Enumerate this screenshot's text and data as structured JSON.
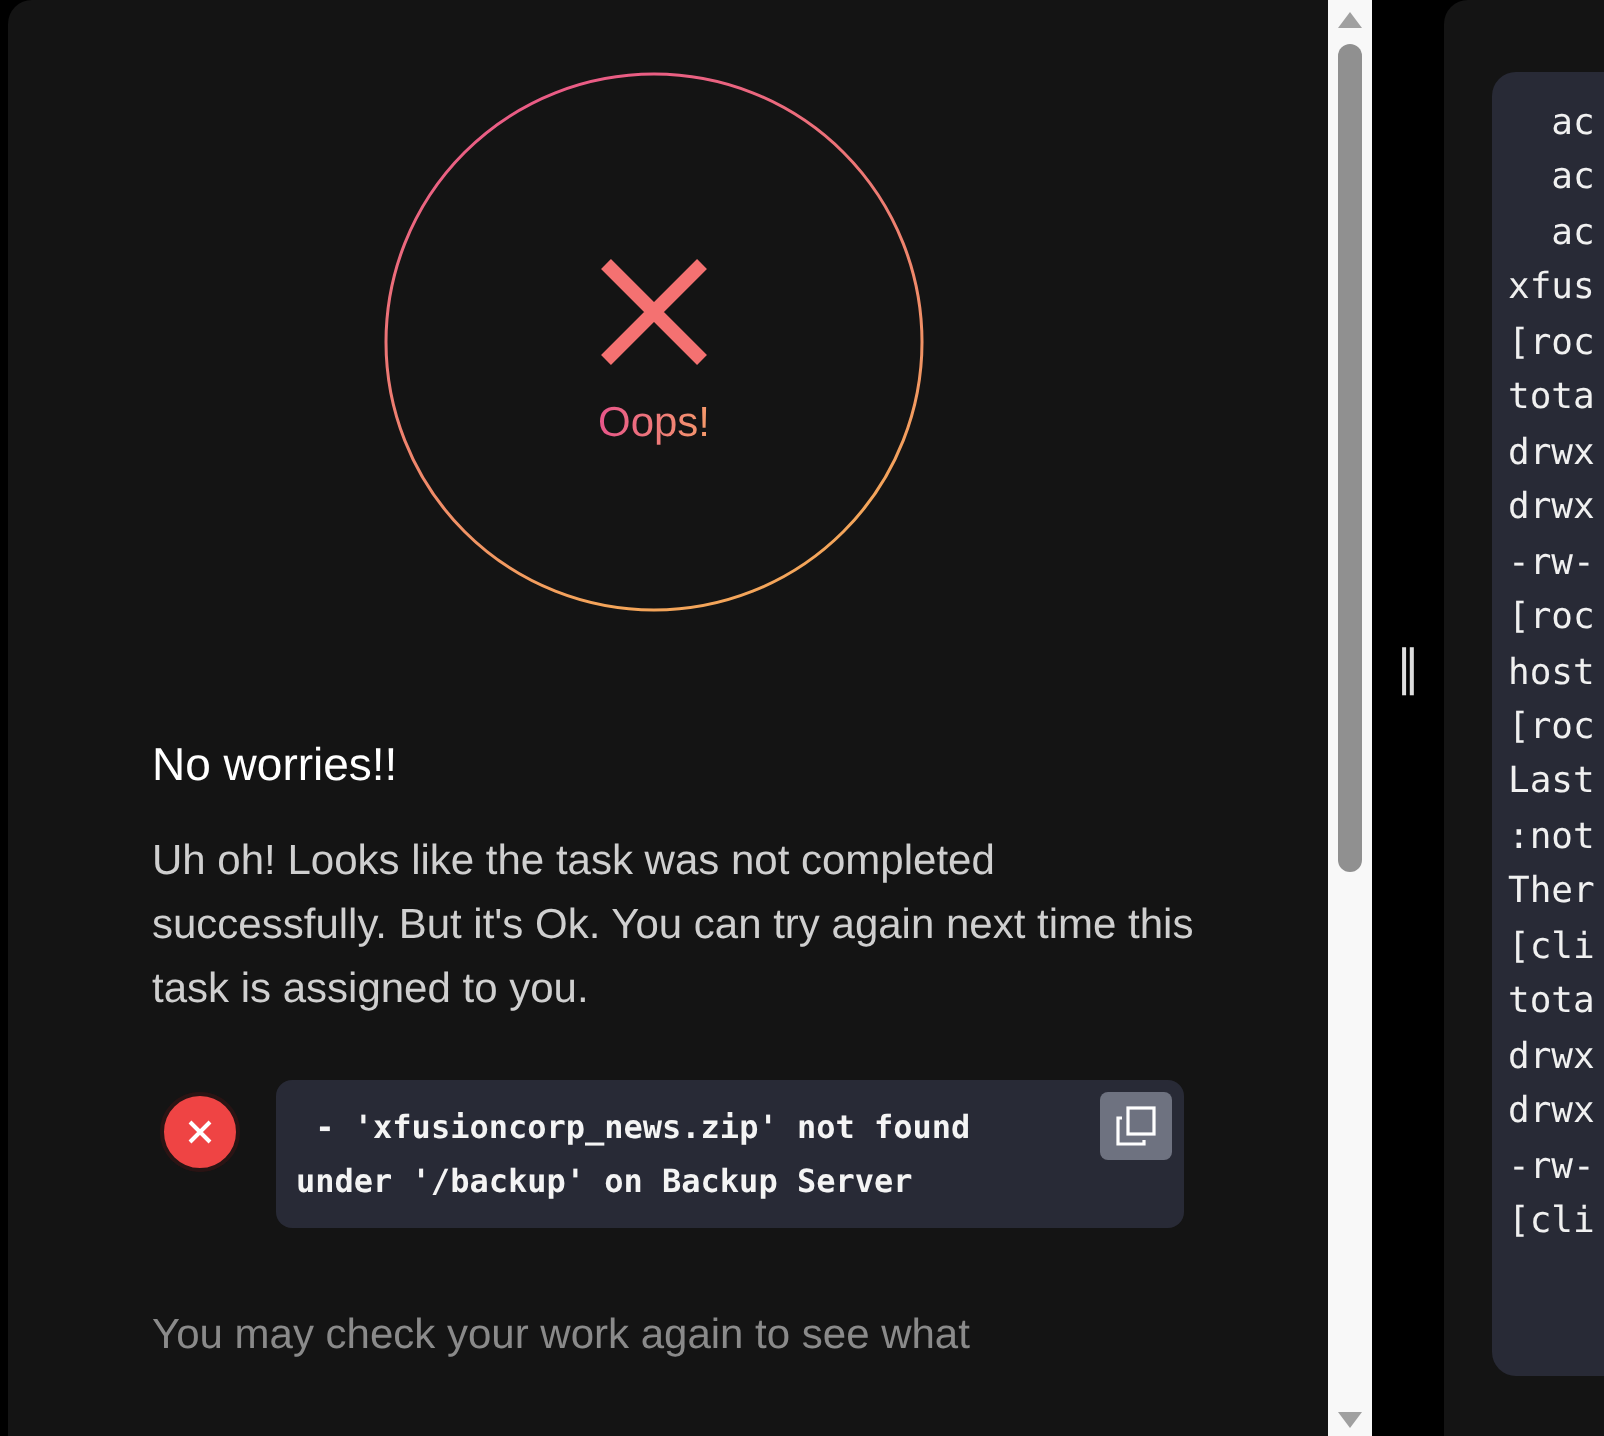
{
  "result": {
    "status_label": "Oops!",
    "heading": "No worries!!",
    "message": "Uh oh! Looks like the task was not completed successfully. But it's Ok. You can try again next time this task is assigned to you.",
    "errors": [
      {
        "text": " - 'xfusioncorp_news.zip' not found under '/backup' on Backup Server"
      }
    ],
    "footer": "You may check your work again to see what"
  },
  "splitter": {
    "label": "‖"
  },
  "terminal": {
    "lines": [
      "  ac",
      "  ac",
      "  ac",
      "xfus",
      "[roc",
      "tota",
      "drwx",
      "drwx",
      "-rw-",
      "[roc",
      "host",
      "[roc",
      "Last",
      ":not",
      "Ther",
      "[cli",
      "tota",
      "drwx",
      "drwx",
      "-rw-",
      "[cli"
    ]
  }
}
